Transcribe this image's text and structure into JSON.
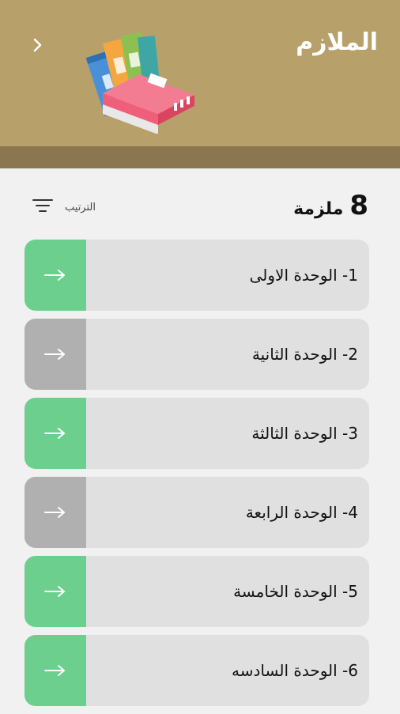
{
  "header": {
    "title": "الملازم",
    "back_icon": "chevron-right-icon",
    "illustration": "books-illustration"
  },
  "summary": {
    "count": "8",
    "count_label": "ملزمة",
    "sort_label": "الترتيب",
    "sort_icon": "filter-lines-icon"
  },
  "colors": {
    "header": "#b8a06a",
    "header_band": "#8a7650",
    "active": "#6ccf8e",
    "inactive": "#b0b0b0",
    "card": "#e0e0e0",
    "background": "#f1f1f1"
  },
  "units": [
    {
      "label": "1- الوحدة الاولى",
      "status": "active"
    },
    {
      "label": "2-  الوحدة الثانية",
      "status": "inactive"
    },
    {
      "label": "3- الوحدة الثالثة",
      "status": "active"
    },
    {
      "label": "4- الوحدة الرابعة",
      "status": "inactive"
    },
    {
      "label": "5- الوحدة الخامسة",
      "status": "active"
    },
    {
      "label": "6- الوحدة السادسه",
      "status": "active"
    }
  ]
}
